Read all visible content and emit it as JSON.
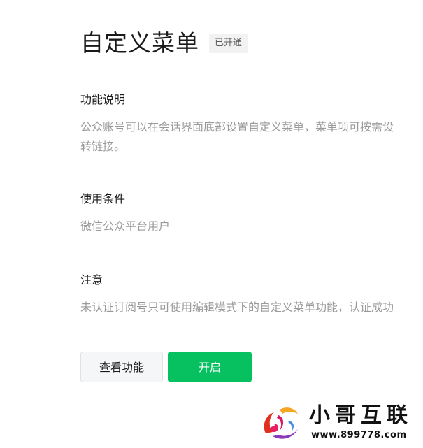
{
  "header": {
    "title": "自定义菜单",
    "status_badge": "已开通"
  },
  "sections": [
    {
      "heading": "功能说明",
      "lines": [
        "公众账号可以在会话界面底部设置自定义菜单，菜单项可按需设",
        "转链接。"
      ]
    },
    {
      "heading": "使用条件",
      "lines": [
        "微信公众平台用户"
      ]
    },
    {
      "heading": "注意",
      "lines": [
        "未认证订阅号只可使用编辑模式下的自定义菜单功能，认证成功"
      ]
    }
  ],
  "actions": {
    "view_label": "查看功能",
    "enable_label": "开启"
  },
  "watermark": {
    "name": "小哥互联",
    "url": "www.899778.com"
  },
  "colors": {
    "primary": "#07c160",
    "muted_text": "#9a9a9a",
    "badge_bg": "#f2f2f2"
  }
}
